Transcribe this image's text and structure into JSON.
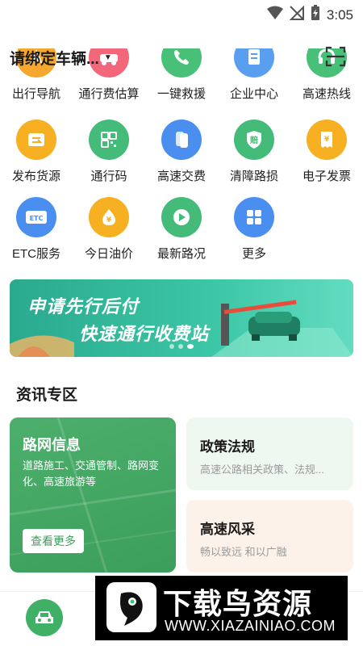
{
  "status_bar": {
    "time": "3:05",
    "icons": [
      "wifi-icon",
      "signal-off-icon",
      "battery-charging-icon"
    ]
  },
  "header": {
    "vehicle_label": "请绑定车辆...",
    "caret": "▼",
    "scan_icon": "scan-icon"
  },
  "services": {
    "row1": [
      {
        "label": "出行导航",
        "icon": "navigation-icon",
        "color": "#f6a82e"
      },
      {
        "label": "通行费估算",
        "icon": "car-fee-icon",
        "color": "#f2687a"
      },
      {
        "label": "一键救援",
        "icon": "phone-icon",
        "color": "#49c078"
      },
      {
        "label": "企业中心",
        "icon": "document-icon",
        "color": "#5a9ef0"
      },
      {
        "label": "高速热线",
        "icon": "hotline-icon",
        "color": "#49c078"
      }
    ],
    "row2": [
      {
        "label": "发布货源",
        "icon": "truck-cargo-icon",
        "color": "#f6b022"
      },
      {
        "label": "通行码",
        "icon": "qr-code-icon",
        "color": "#45bb7a"
      },
      {
        "label": "高速交费",
        "icon": "card-pay-icon",
        "color": "#4a8ff0"
      },
      {
        "label": "清障路损",
        "icon": "compensation-shield-icon",
        "color": "#45bb7a"
      },
      {
        "label": "电子发票",
        "icon": "invoice-icon",
        "color": "#f6b022"
      }
    ],
    "row3": [
      {
        "label": "ETC服务",
        "icon": "etc-card-icon",
        "color": "#4a8ff0",
        "badge": "ETC"
      },
      {
        "label": "今日油价",
        "icon": "oil-price-icon",
        "color": "#f6b022"
      },
      {
        "label": "最新路况",
        "icon": "play-video-icon",
        "color": "#45bb7a"
      },
      {
        "label": "更多",
        "icon": "more-grid-icon",
        "color": "#4a8ff0"
      }
    ]
  },
  "banner": {
    "line1": "申请先行后付",
    "line2": "快速通行收费站",
    "active_slide": 2,
    "slide_count": 3
  },
  "news": {
    "title": "资讯专区",
    "road_info": {
      "title": "路网信息",
      "desc": "道路施工、交通管制、路网变化、高速旅游等",
      "button": "查看更多"
    },
    "policy": {
      "title": "政策法规",
      "desc": "高速公路相关政策、法规..."
    },
    "scenery": {
      "title": "高速风采",
      "desc": "畅以致远 和以广融"
    }
  },
  "watermark": {
    "title": "下载鸟资源",
    "url": "WWW.XIAZAINIAO.COM"
  }
}
